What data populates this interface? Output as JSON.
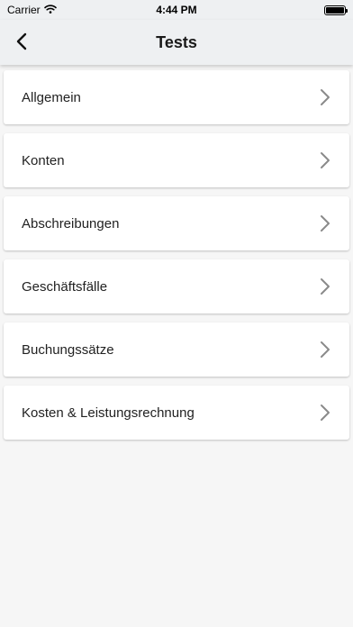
{
  "status_bar": {
    "carrier": "Carrier",
    "time": "4:44 PM"
  },
  "header": {
    "title": "Tests",
    "back_icon": "chevron-left-icon"
  },
  "list": {
    "items": [
      {
        "label": "Allgemein"
      },
      {
        "label": "Konten"
      },
      {
        "label": "Abschreibungen"
      },
      {
        "label": "Geschäftsfälle"
      },
      {
        "label": "Buchungssätze"
      },
      {
        "label": "Kosten & Leistungsrechnung"
      }
    ],
    "item_icon": "chevron-right-icon"
  },
  "colors": {
    "header_bg": "#eef0f2",
    "page_bg": "#f6f6f6",
    "card_bg": "#ffffff",
    "chevron": "#8a8a8a"
  }
}
